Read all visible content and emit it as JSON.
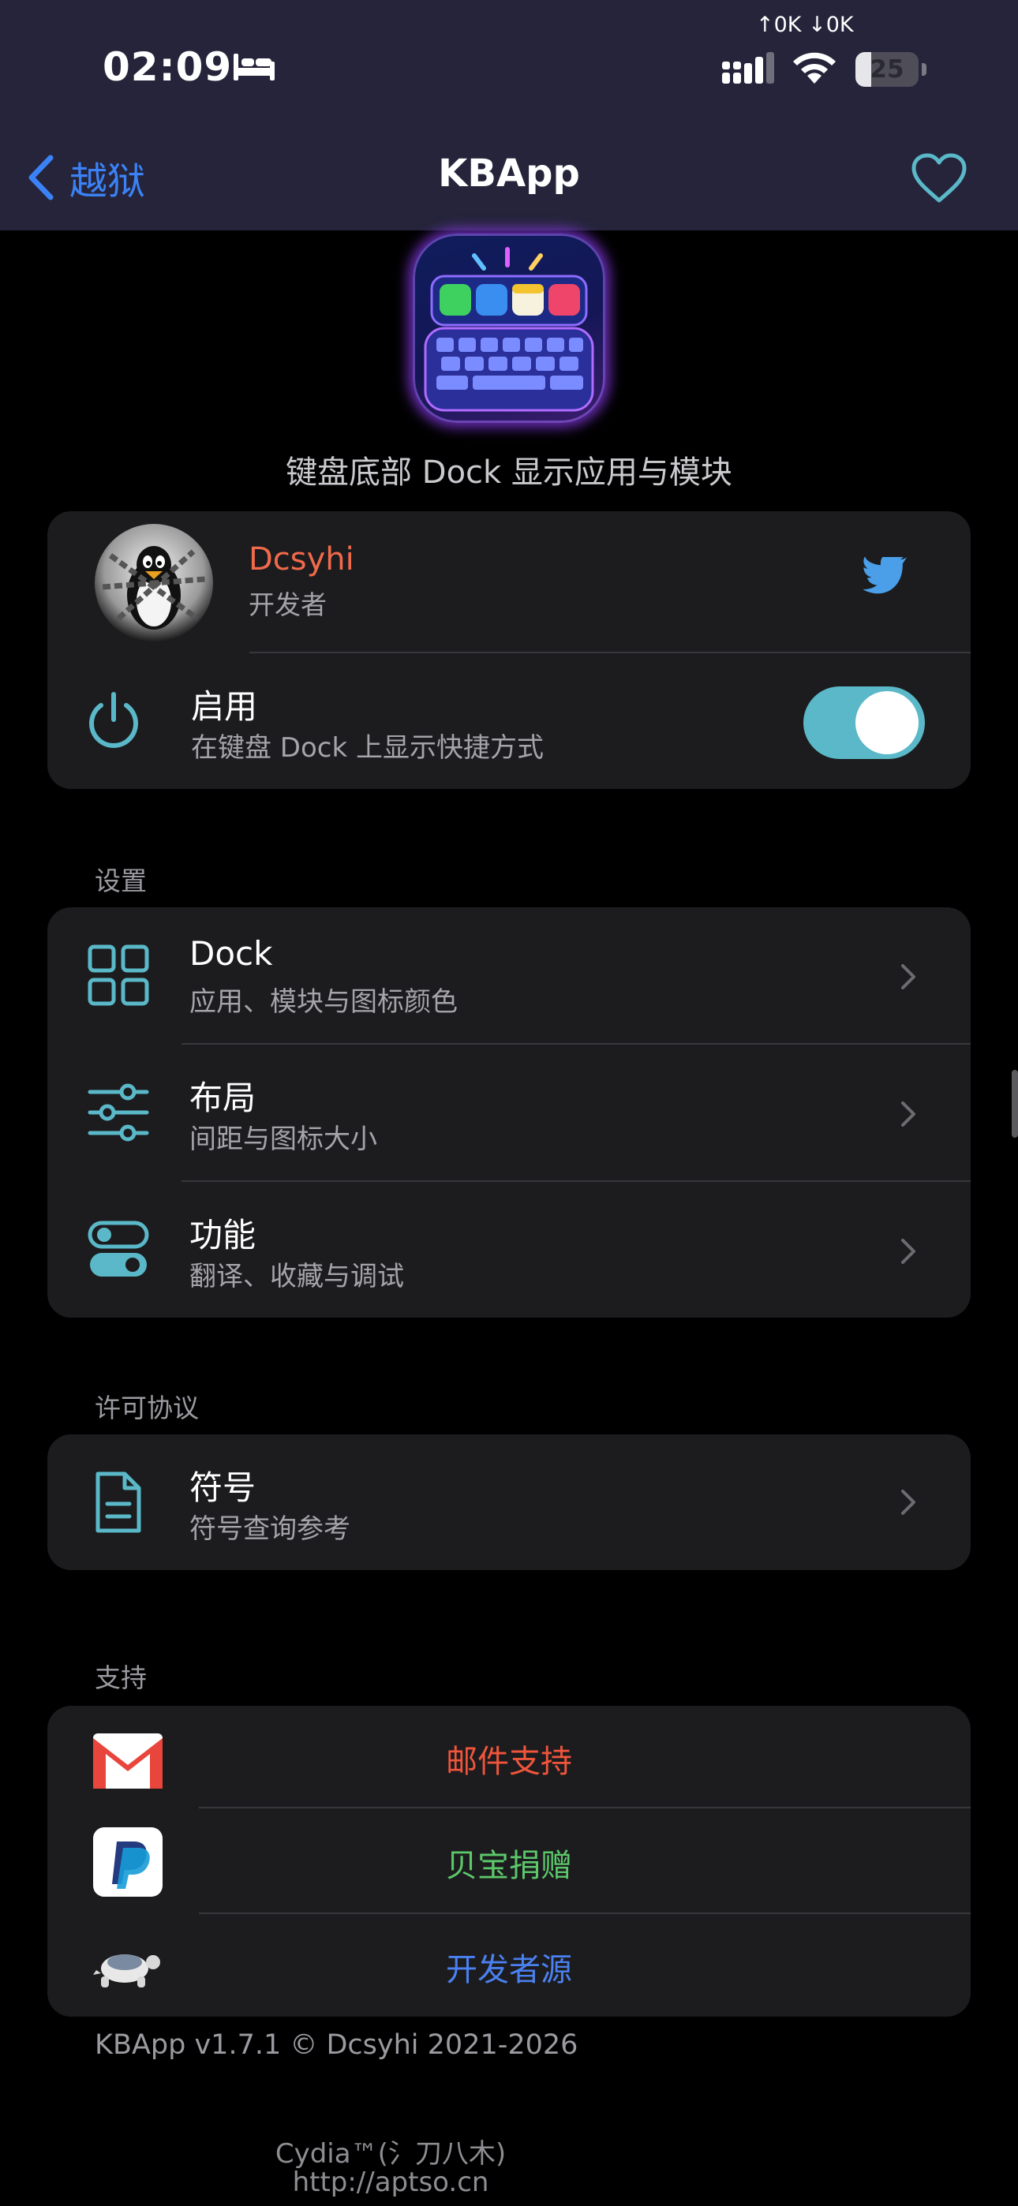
{
  "status_bar": {
    "time": "02:09",
    "network_speed": "↑0K ↓0K",
    "battery": "25",
    "battery_level": 0.25,
    "icons": [
      "bed-icon",
      "cellular-signal-icon",
      "wifi-icon",
      "battery-icon"
    ]
  },
  "nav": {
    "back_label": "越狱",
    "title": "KBApp",
    "right_icon": "heart-icon"
  },
  "header": {
    "tagline": "键盘底部 Dock 显示应用与模块"
  },
  "developer": {
    "name": "Dcsyhi",
    "role": "开发者",
    "social_icon": "twitter-icon"
  },
  "enable": {
    "title": "启用",
    "subtitle": "在键盘 Dock 上显示快捷方式",
    "on": true
  },
  "settings": {
    "header": "设置",
    "items": [
      {
        "title": "Dock",
        "subtitle": "应用、模块与图标颜色",
        "icon": "grid-icon"
      },
      {
        "title": "布局",
        "subtitle": "间距与图标大小",
        "icon": "sliders-icon"
      },
      {
        "title": "功能",
        "subtitle": "翻译、收藏与调试",
        "icon": "toggles-icon"
      }
    ]
  },
  "license": {
    "header": "许可协议",
    "items": [
      {
        "title": "符号",
        "subtitle": "符号查询参考",
        "icon": "document-icon"
      }
    ]
  },
  "support": {
    "header": "支持",
    "items": [
      {
        "label": "邮件支持",
        "icon": "gmail-icon",
        "color": "#f0553c"
      },
      {
        "label": "贝宝捐赠",
        "icon": "paypal-icon",
        "color": "#5cc86a"
      },
      {
        "label": "开发者源",
        "icon": "git-turtle-icon",
        "color": "#4a80f0"
      }
    ]
  },
  "footer": {
    "copyright": "KBApp v1.7.1 © Dcsyhi 2021-2026"
  },
  "watermark": {
    "line1": "Cydia™(氵刀八木)",
    "line2": "http://aptso.cn"
  },
  "colors": {
    "accent_teal": "#5ab8c8",
    "link_blue": "#3b82f6",
    "developer_name": "#f06a4b",
    "twitter_blue": "#4a9fe8"
  }
}
